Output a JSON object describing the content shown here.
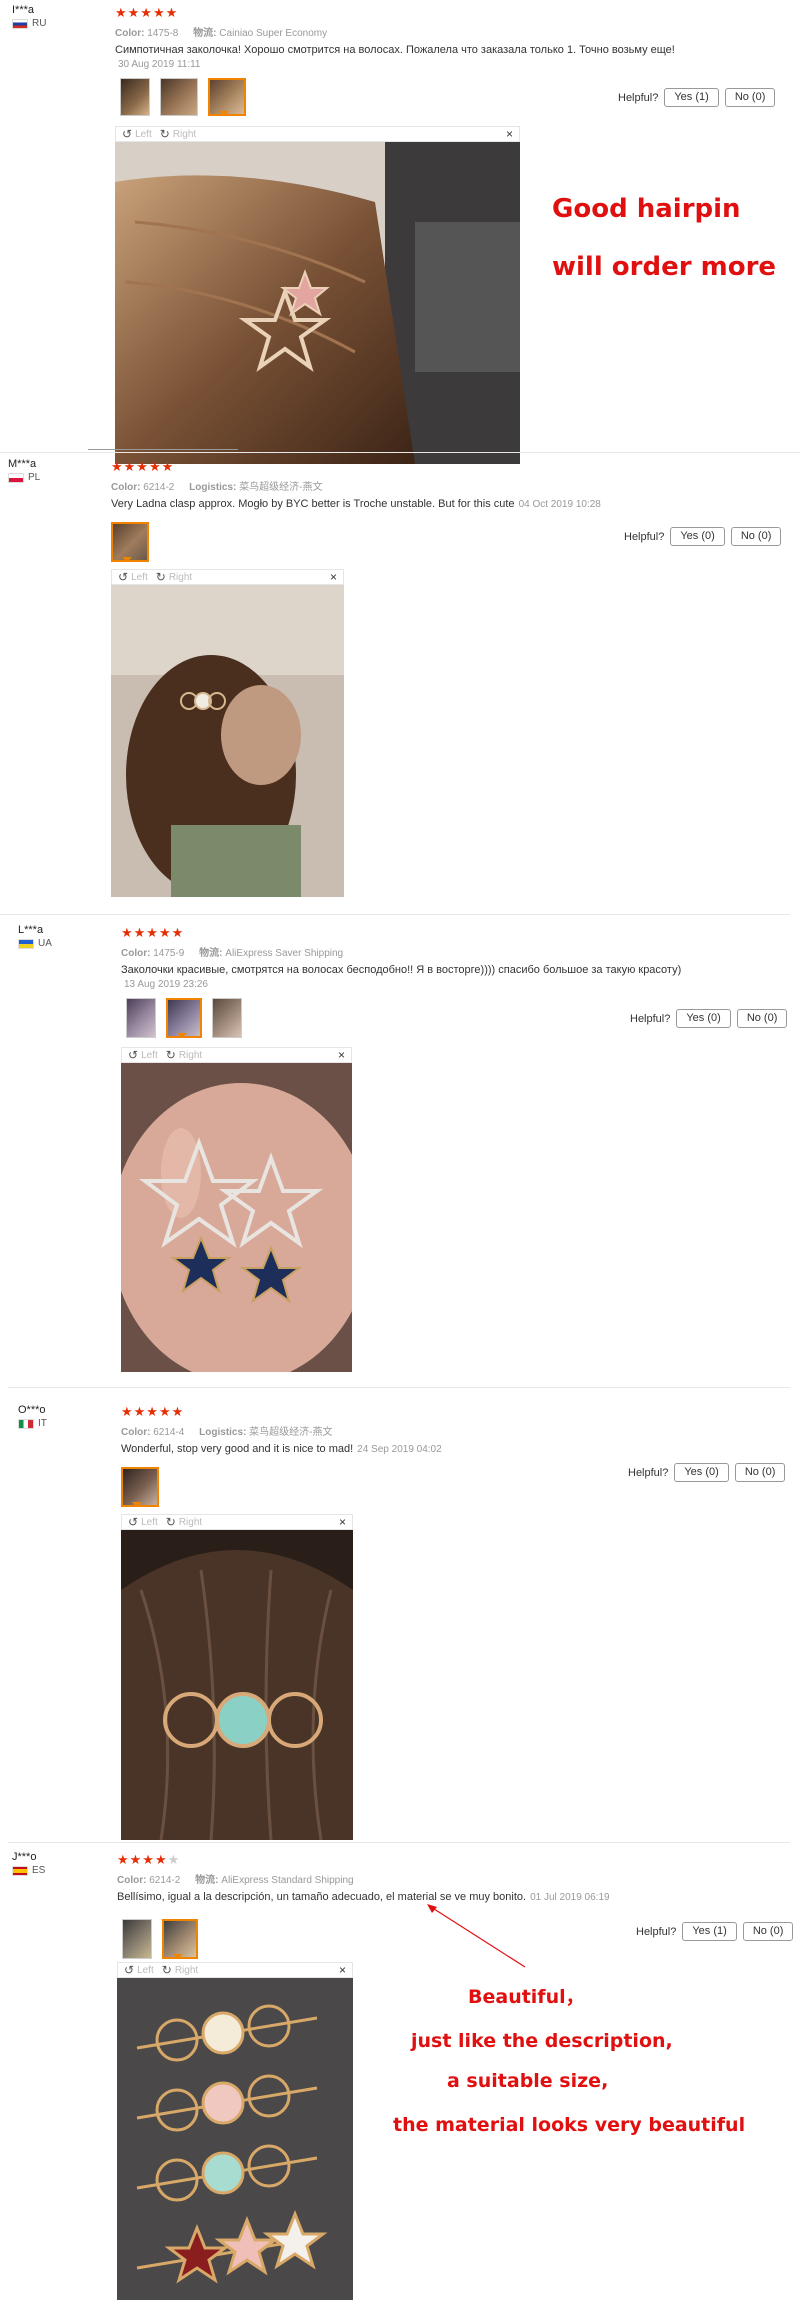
{
  "helpful_label": "Helpful?",
  "viewer": {
    "left": "Left",
    "right": "Right",
    "close": "×"
  },
  "reviews": [
    {
      "user": "I***a",
      "country": "RU",
      "stars": "★★★★★",
      "color_label": "Color:",
      "color": "1475-8",
      "ship_label": "物流:",
      "shipping": "Cainiao Super Economy",
      "text": "Симпотичная заколочка! Хорошо смотрится на волосах. Пожалела что заказала только 1. Точно возьму еще!",
      "date": "30 Aug 2019 11:11",
      "yes": "Yes (1)",
      "no": "No (0)"
    },
    {
      "user": "M***a",
      "country": "PL",
      "stars": "★★★★★",
      "color_label": "Color:",
      "color": "6214-2",
      "ship_label": "Logistics:",
      "shipping": "菜鸟超级经济-燕文",
      "text": "Very Ladna clasp approx. Mogło by BYC better is Troche unstable. But for this cute",
      "date": "04 Oct 2019 10:28",
      "yes": "Yes (0)",
      "no": "No (0)"
    },
    {
      "user": "L***a",
      "country": "UA",
      "stars": "★★★★★",
      "color_label": "Color:",
      "color": "1475-9",
      "ship_label": "物流:",
      "shipping": "AliExpress Saver Shipping",
      "text": "Заколочки красивые, смотрятся на волосах бесподобно!! Я в восторге)))) спасибо большое за такую красоту)",
      "date": "13 Aug 2019 23:26",
      "yes": "Yes (0)",
      "no": "No (0)"
    },
    {
      "user": "O***o",
      "country": "IT",
      "stars": "★★★★★",
      "color_label": "Color:",
      "color": "6214-4",
      "ship_label": "Logistics:",
      "shipping": "菜鸟超级经济-燕文",
      "text": "Wonderful, stop very good and it is nice to mad!",
      "date": "24 Sep 2019 04:02",
      "yes": "Yes (0)",
      "no": "No (0)"
    },
    {
      "user": "J***o",
      "country": "ES",
      "stars": "★★★★",
      "stars_off": "★",
      "color_label": "Color:",
      "color": "6214-2",
      "ship_label": "物流:",
      "shipping": "AliExpress Standard Shipping",
      "text": "Bellísimo, igual a la descripción, un tamaño adecuado, el material se ve muy bonito.",
      "date": "01 Jul 2019 06:19",
      "yes": "Yes (1)",
      "no": "No (0)"
    }
  ],
  "annotations": {
    "a1_line1": "Good hairpin",
    "a1_line2": "will order more",
    "a5_line1": "Beautiful，",
    "a5_line2": "just like the description,",
    "a5_line3": "a suitable size,",
    "a5_line4": "the material looks very beautiful"
  },
  "colors": {
    "accent": "#e62e04",
    "annotation": "#e01010",
    "thumb_active": "#f08400"
  }
}
